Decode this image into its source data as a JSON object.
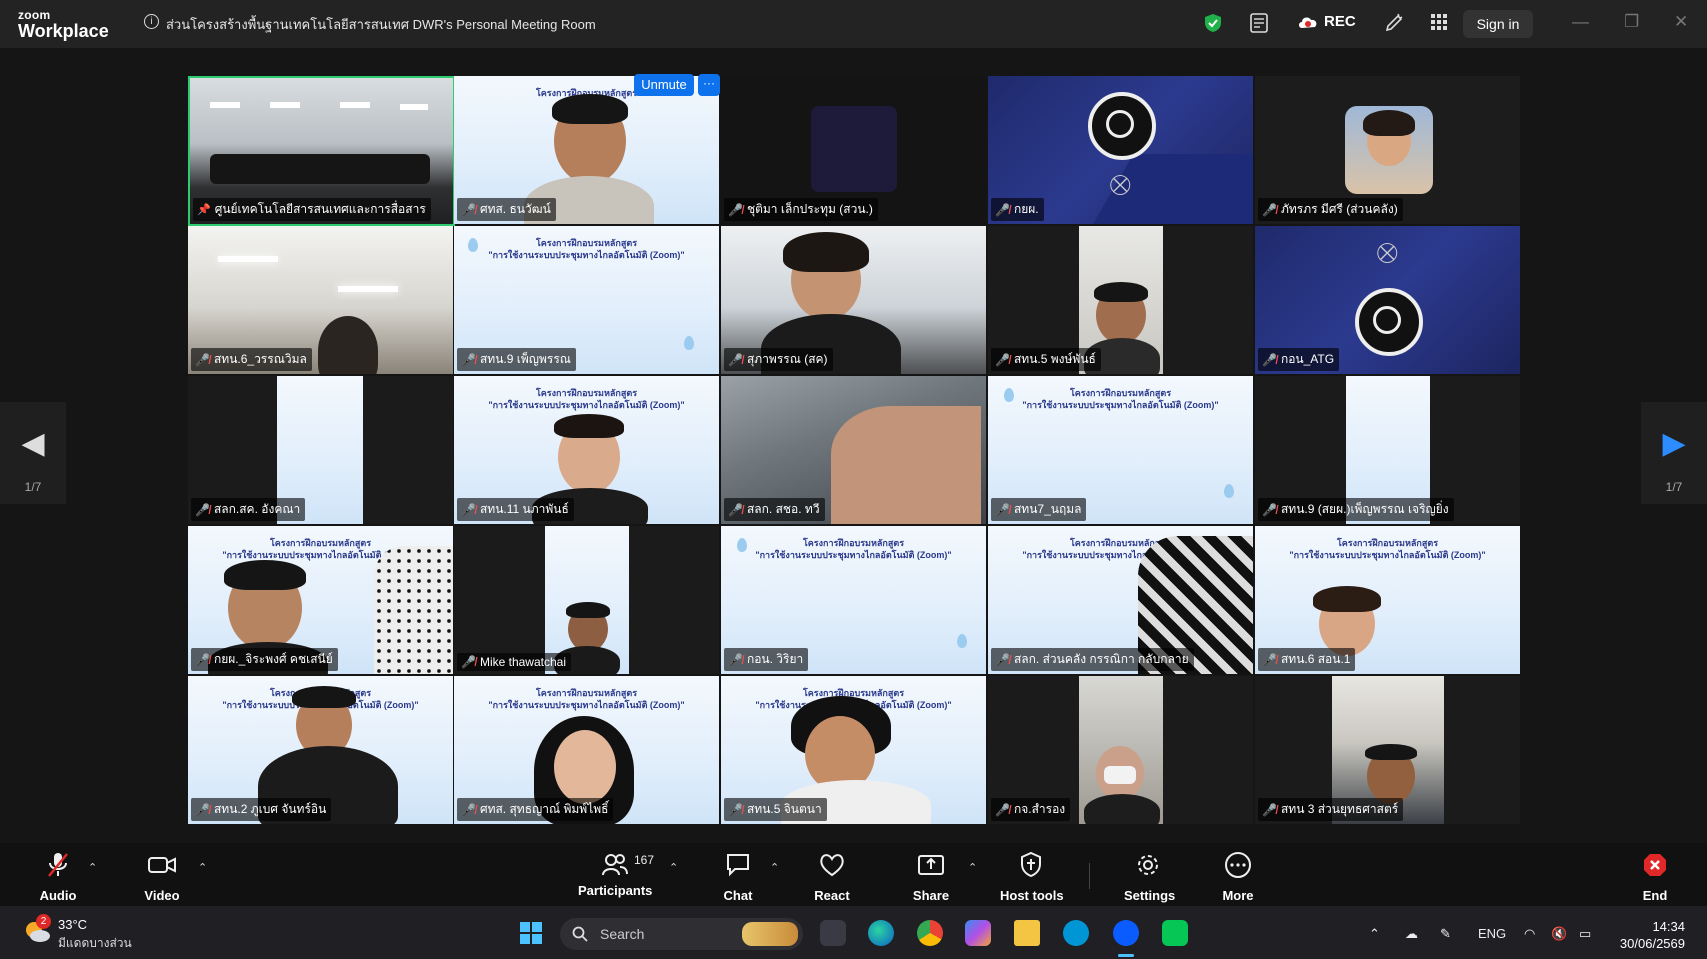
{
  "titlebar": {
    "brand_top": "zoom",
    "brand_bottom": "Workplace",
    "meeting_title": "ส่วนโครงสร้างพื้นฐานเทคโนโลยีสารสนเทศ DWR's Personal Meeting Room",
    "rec_label": "REC",
    "sign_in_label": "Sign in"
  },
  "banner": {
    "unmute_label": "Unmute",
    "more_label": "···"
  },
  "slide": {
    "line1": "โครงการฝึกอบรมหลักสูตร",
    "line2": "\"การใช้งานระบบประชุมทางไกลอัตโนมัติ (Zoom)\""
  },
  "participants": [
    {
      "name": "ศูนย์เทคโนโลยีสารสนเทศและการสื่อสาร",
      "muted": false,
      "pinned": true
    },
    {
      "name": "ศทส. ธนวัฒน์",
      "muted": true
    },
    {
      "name": "ชุติมา เล็กประทุม (สวน.)",
      "muted": true
    },
    {
      "name": "กยผ.",
      "muted": true
    },
    {
      "name": "ภัทรภร มีศรี (ส่วนคลัง)",
      "muted": true
    },
    {
      "name": "สทน.6_วรรณวิมล",
      "muted": true
    },
    {
      "name": "สทน.9 เพ็ญพรรณ",
      "muted": true
    },
    {
      "name": "สุภาพรรณ (สค)",
      "muted": true
    },
    {
      "name": "สทน.5 พงษ์พันธ์",
      "muted": true
    },
    {
      "name": "กอน_ATG",
      "muted": true
    },
    {
      "name": "สลก.สค. อังคณา",
      "muted": true
    },
    {
      "name": "สทน.11 นภาพันธ์",
      "muted": true
    },
    {
      "name": "สลก. สชอ. ทวี",
      "muted": true
    },
    {
      "name": "สทน7_นฤมล",
      "muted": true
    },
    {
      "name": "สทน.9 (สยผ.)เพ็ญพรรณ เจริญยิ่ง",
      "muted": true
    },
    {
      "name": "กยผ._จิระพงศ์ คชเสนีย์",
      "muted": true
    },
    {
      "name": "Mike thawatchai",
      "muted": true
    },
    {
      "name": "กอน. วิริยา",
      "muted": true
    },
    {
      "name": "สลก. ส่วนคลัง กรรณิกา กลับกลาย",
      "muted": true
    },
    {
      "name": "สทน.6 สอน.1",
      "muted": true
    },
    {
      "name": "สทน.2 ภูเบศ จันทร์อิน",
      "muted": true
    },
    {
      "name": "ศทส. สุทธญาณ์ พิมพ์ไพธิ์",
      "muted": true
    },
    {
      "name": "สทน.5 จินตนา",
      "muted": true
    },
    {
      "name": "กจ.สำรอง",
      "muted": true
    },
    {
      "name": "สทน 3 ส่วนยุทธศาสตร์",
      "muted": true
    }
  ],
  "pager": {
    "current": "1/7"
  },
  "toolbar": {
    "audio": "Audio",
    "video": "Video",
    "participants": "Participants",
    "participant_count": "167",
    "chat": "Chat",
    "react": "React",
    "share": "Share",
    "host_tools": "Host tools",
    "settings": "Settings",
    "more": "More",
    "end": "End"
  },
  "taskbar": {
    "weather_badge": "2",
    "temperature": "33°C",
    "weather_desc": "มีแดดบางส่วน",
    "search_label": "Search",
    "lang": "ENG",
    "time": "14:34",
    "date": "30/06/2569"
  },
  "colors": {
    "accent": "#0e72ed",
    "active_speaker": "#2ecc71",
    "mute": "#f34e4e",
    "end": "#e02828"
  }
}
